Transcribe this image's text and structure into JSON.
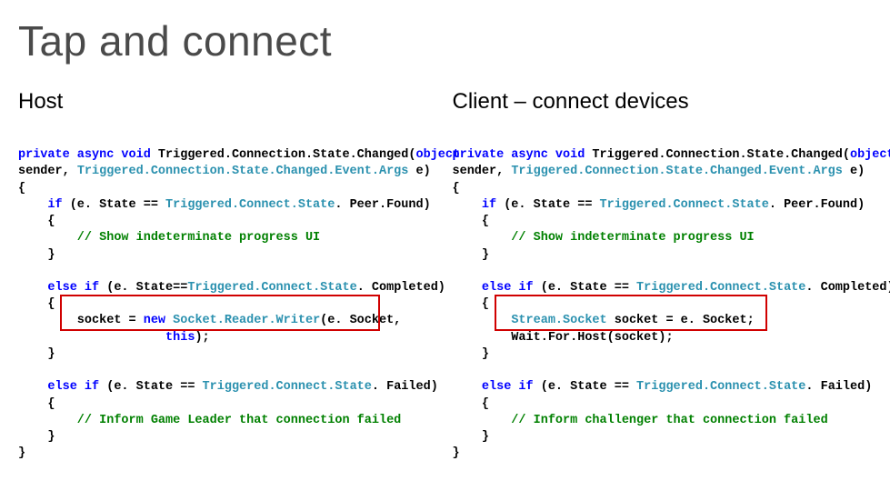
{
  "title": "Tap and connect",
  "left": {
    "heading": "Host",
    "sig1": "private async void",
    "sig2": " Triggered.Connection.State.Changed(",
    "sig3": "object",
    "line2a": "sender, ",
    "line2b": "Triggered.Connection.State.Changed.Event.Args",
    "line2c": " e)",
    "brace_open": "{",
    "if1a": "    if",
    "if1b": " (e. State == ",
    "if1c": "Triggered.Connect.State",
    "if1d": ". Peer.Found)",
    "brace1o": "    {",
    "com1": "        // Show indeterminate progress UI",
    "brace1c": "    }",
    "blank": "",
    "elif1a": "    else if",
    "elif1b": " (e. State==",
    "elif1c": "Triggered.Connect.State",
    "elif1d": ". Completed)",
    "brace2o": "    {",
    "box1a": "        socket = ",
    "box1b": "new ",
    "box1c": "Socket.Reader.Writer",
    "box1d": "(e. Socket,",
    "box2a": "                    ",
    "box2b": "this",
    "box2c": ");",
    "brace2c": "    }",
    "elif2a": "    else if",
    "elif2b": " (e. State == ",
    "elif2c": "Triggered.Connect.State",
    "elif2d": ". Failed)",
    "brace3o": "    {",
    "com2": "        // Inform Game Leader that connection failed",
    "brace3c": "    }",
    "brace_close": "}"
  },
  "right": {
    "heading": "Client – connect devices",
    "sig1": "private async void",
    "sig2": " Triggered.Connection.State.Changed(",
    "sig3": "object",
    "line2a": "sender, ",
    "line2b": "Triggered.Connection.State.Changed.Event.Args",
    "line2c": " e)",
    "brace_open": "{",
    "if1a": "    if",
    "if1b": " (e. State == ",
    "if1c": "Triggered.Connect.State",
    "if1d": ". Peer.Found)",
    "brace1o": "    {",
    "com1": "        // Show indeterminate progress UI",
    "brace1c": "    }",
    "blank": "",
    "elif1a": "    else if",
    "elif1b": " (e. State == ",
    "elif1c": "Triggered.Connect.State",
    "elif1d": ". Completed)",
    "brace2o": "    {",
    "box1a": "        ",
    "box1b": "Stream.Socket",
    "box1c": " socket = e. Socket;",
    "box2a": "        Wait.For.Host(socket);",
    "brace2c": "    }",
    "elif2a": "    else if",
    "elif2b": " (e. State == ",
    "elif2c": "Triggered.Connect.State",
    "elif2d": ". Failed)",
    "brace3o": "    {",
    "com2": "        // Inform challenger that connection failed",
    "brace3c": "    }",
    "brace_close": "}"
  }
}
